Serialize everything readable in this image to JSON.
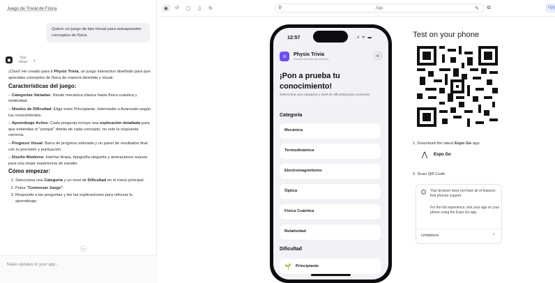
{
  "left": {
    "project_title": "Juego de Trivial de Física",
    "user_message": "Quiero un juego de tipo trivual para autoaprender conceptos de física",
    "steps_label": "See steps",
    "intro_pre": "¡Claro! He creado para ti ",
    "intro_bold": "Physix Trivia",
    "intro_post": ", un juego interactivo diseñado para que aprendas conceptos de física de manera divertida y visual.",
    "features_heading": "Características del juego:",
    "features": [
      {
        "title": "Categorías Variadas",
        "text": ": Desde mecánica clásica hasta física cuántica y relatividad."
      },
      {
        "title": "Niveles de Dificultad",
        "text": ": Elige entre Principiante, Intermedio o Avanzado según tus conocimientos."
      },
      {
        "title": "Aprendizaje Activo",
        "text": ": Cada pregunta incluye una "
      },
      {
        "title": "Progreso Visual",
        "text": ": Barra de progreso animada y un panel de resultados final con tu precisión y puntuación."
      },
      {
        "title": "Diseño Moderno",
        "text": ": Interfaz limpia, tipografía elegante y animaciones suaves para una mejor experiencia de estudio."
      }
    ],
    "feat3_bold2": "explicación detallada",
    "feat3_tail": " para que entiendas el \"porqué\" detrás de cada concepto, no solo la respuesta correcta.",
    "howto_heading": "Cómo empezar:",
    "howto": {
      "s1_a": "Selecciona una ",
      "s1_b": "Categoría",
      "s1_c": " y un nivel de ",
      "s1_d": "Dificultad",
      "s1_e": " en el menú principal.",
      "s2_a": "Pulsa ",
      "s2_b": "\"Comenzar Juego\"",
      "s2_c": ".",
      "s3": "Responde a las preguntas y lee las explicaciones para reforzar tu aprendizaje."
    },
    "input_placeholder": "Make updates to your app..."
  },
  "topbar": {
    "url": "App",
    "upgrade": "Upg"
  },
  "phone": {
    "time": "12:57",
    "status_icons": ".ıl ᯤ ▬",
    "app_name": "Physix Trivia",
    "app_sub": "Domina las leyes del universo",
    "hero": "¡Pon a prueba tu conocimiento!",
    "hero_sub": "Selecciona una categoría y nivel de dificultad para comenzar",
    "category_heading": "Categoría",
    "categories": [
      "Mecánica",
      "Termodinámica",
      "Electromagnetismo",
      "Óptica",
      "Física Cuántica",
      "Relatividad"
    ],
    "difficulty_heading": "Dificultad",
    "difficulty_first": "Principiante"
  },
  "test": {
    "title": "Test on your phone",
    "step1_pre": "1. Download the latest ",
    "step1_bold": "Expo Go",
    "step1_post": " app",
    "expo_label": "Expo Go",
    "step2": "2. Scan QR Code",
    "info1": "Your browser does not have all of features that phones support.",
    "info2": "For the full experience, test your app on your phone using the Expo Go app.",
    "limitations": "Limitations"
  }
}
